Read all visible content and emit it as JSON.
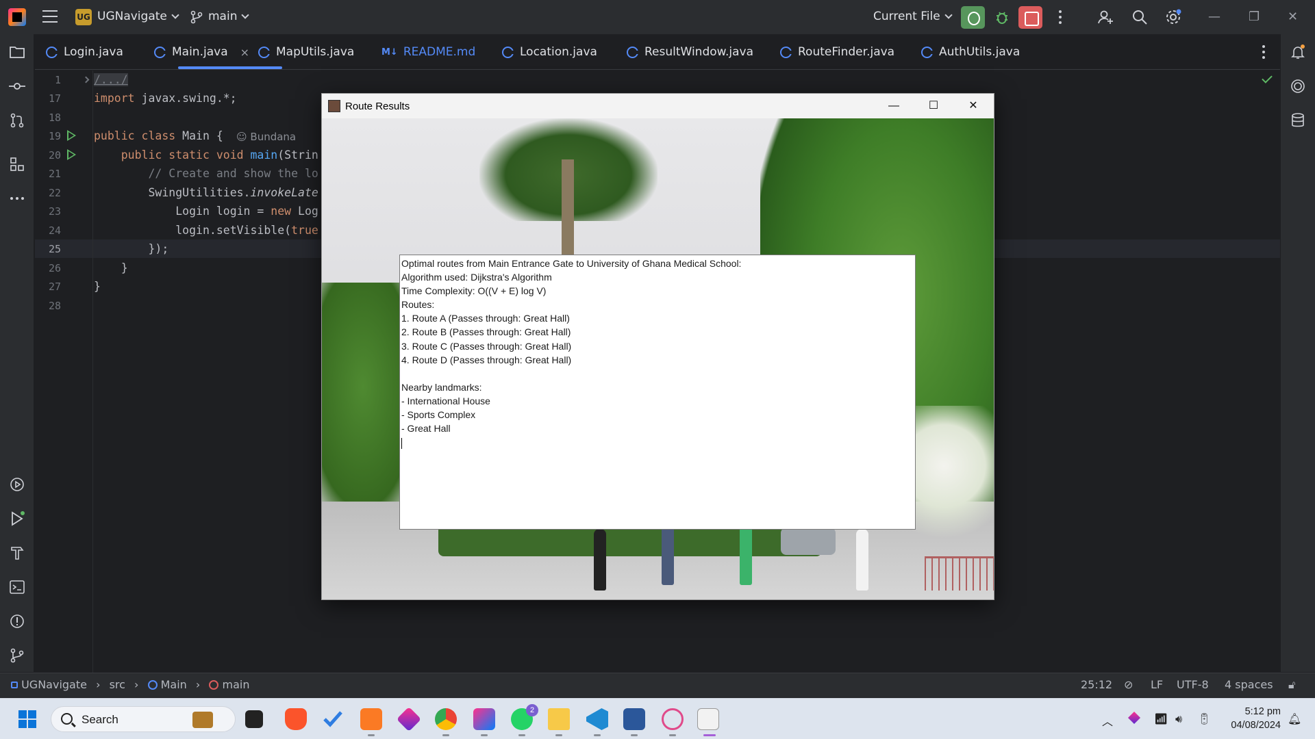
{
  "titlebar": {
    "project_badge": "UG",
    "project_name": "UGNavigate",
    "branch": "main",
    "run_config": "Current File"
  },
  "tabs": [
    {
      "label": "Login.java"
    },
    {
      "label": "Main.java",
      "active": true
    },
    {
      "label": "MapUtils.java"
    },
    {
      "label": "README.md",
      "md_icon": "M↓"
    },
    {
      "label": "Location.java"
    },
    {
      "label": "ResultWindow.java"
    },
    {
      "label": "RouteFinder.java"
    },
    {
      "label": "AuthUtils.java"
    }
  ],
  "editor": {
    "line_numbers": [
      "1",
      "17",
      "18",
      "19",
      "20",
      "21",
      "22",
      "23",
      "24",
      "25",
      "26",
      "27",
      "28"
    ],
    "author": "Bundana",
    "lines": {
      "l1": "/.../",
      "l17_kw": "import",
      "l17_rest": " javax.swing.*;",
      "l19_kw": "public class",
      "l19_rest": " Main {",
      "l20_kw": "public static void",
      "l20_fn": "main",
      "l20_rest": "(Strin",
      "l21": "// Create and show the lo",
      "l22_a": "SwingUtilities.",
      "l22_b": "invokeLate",
      "l23_a": "Login login = ",
      "l23_kw": "new",
      "l23_b": " Log",
      "l24_a": "login.setVisible(",
      "l24_kw": "true",
      "l25": "});",
      "l26": "}",
      "l27": "}"
    }
  },
  "statusbar": {
    "breadcrumb": [
      "UGNavigate",
      "src",
      "Main",
      "main"
    ],
    "position": "25:12",
    "line_sep": "LF",
    "encoding": "UTF-8",
    "indent": "4 spaces"
  },
  "route_window": {
    "title": "Route Results",
    "result_text": "Optimal routes from Main Entrance Gate to University of Ghana Medical School:\nAlgorithm used: Dijkstra's Algorithm\nTime Complexity: O((V + E) log V)\nRoutes:\n1. Route A (Passes through: Great Hall)\n2. Route B (Passes through: Great Hall)\n3. Route C (Passes through: Great Hall)\n4. Route D (Passes through: Great Hall)\n\nNearby landmarks:\n- International House\n- Sports Complex\n- Great Hall\n"
  },
  "taskbar": {
    "search_label": "Search",
    "whatsapp_badge": "2",
    "time": "5:12 pm",
    "date": "04/08/2024"
  },
  "colors": {
    "ide_bg": "#1e1f22",
    "ide_panel": "#2b2d30",
    "accent_blue": "#548af7",
    "run_green": "#57965c",
    "stop_red": "#db5c5c",
    "keyword": "#cf8e6d",
    "function": "#56a8f5"
  }
}
